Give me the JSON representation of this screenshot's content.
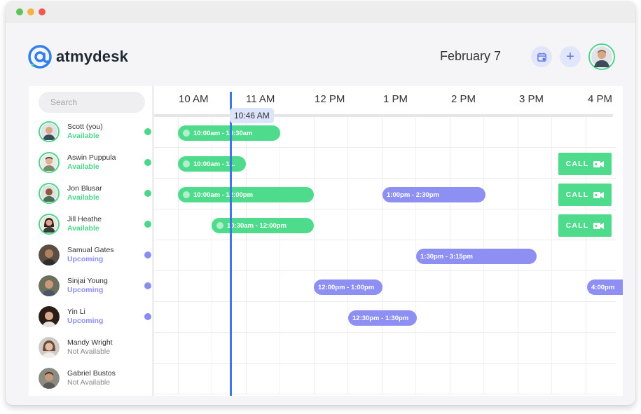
{
  "window": {
    "controls": [
      "close",
      "minimize",
      "maximize"
    ]
  },
  "brand": {
    "name": "atmydesk",
    "icon": "at-sign-icon",
    "accent": "#2f80ed"
  },
  "header": {
    "date": "February 7",
    "calendar_icon": "calendar-icon",
    "add_icon": "plus-icon",
    "add_label": "+"
  },
  "search": {
    "placeholder": "Search",
    "value": ""
  },
  "timeline": {
    "hours": [
      "10 AM",
      "11 AM",
      "12 PM",
      "1 PM",
      "2 PM",
      "3 PM",
      "4 PM"
    ],
    "current_time": "10:46 AM"
  },
  "colors": {
    "available": "#4cd68a",
    "upcoming": "#8a8cf0",
    "now_line": "#3f78e0"
  },
  "people": [
    {
      "name": "Scott (you)",
      "status": "Available",
      "status_type": "available"
    },
    {
      "name": "Aswin Puppula",
      "status": "Available",
      "status_type": "available"
    },
    {
      "name": "Jon Blusar",
      "status": "Available",
      "status_type": "available"
    },
    {
      "name": "Jill Heathe",
      "status": "Available",
      "status_type": "available"
    },
    {
      "name": "Samual Gates",
      "status": "Upcoming",
      "status_type": "upcoming"
    },
    {
      "name": "Sinjai Young",
      "status": "Upcoming",
      "status_type": "upcoming"
    },
    {
      "name": "Yin Li",
      "status": "Upcoming",
      "status_type": "upcoming"
    },
    {
      "name": "Mandy Wright",
      "status": "Not Available",
      "status_type": "na"
    },
    {
      "name": "Gabriel Bustos",
      "status": "Not Available",
      "status_type": "na"
    }
  ],
  "events": [
    {
      "label": "10:00am - 10:30am",
      "row": 0,
      "color": "green"
    },
    {
      "label": "10:00am - 1...",
      "row": 1,
      "color": "green"
    },
    {
      "label": "10:00am - 12:00pm",
      "row": 2,
      "color": "green"
    },
    {
      "label": "1:00pm - 2:30pm",
      "row": 2,
      "color": "purple"
    },
    {
      "label": "10:30am - 12:00pm",
      "row": 3,
      "color": "green"
    },
    {
      "label": "1:30pm - 3:15pm",
      "row": 4,
      "color": "purple"
    },
    {
      "label": "12:00pm - 1:00pm",
      "row": 5,
      "color": "purple"
    },
    {
      "label": "4:00pm",
      "row": 5,
      "color": "purple"
    },
    {
      "label": "12:30pm - 1:30pm",
      "row": 6,
      "color": "purple"
    }
  ],
  "call_buttons": [
    {
      "label": "CALL",
      "row": 1,
      "icon": "video-camera-icon"
    },
    {
      "label": "CALL",
      "row": 2,
      "icon": "video-camera-icon"
    },
    {
      "label": "CALL",
      "row": 3,
      "icon": "video-camera-icon"
    }
  ]
}
